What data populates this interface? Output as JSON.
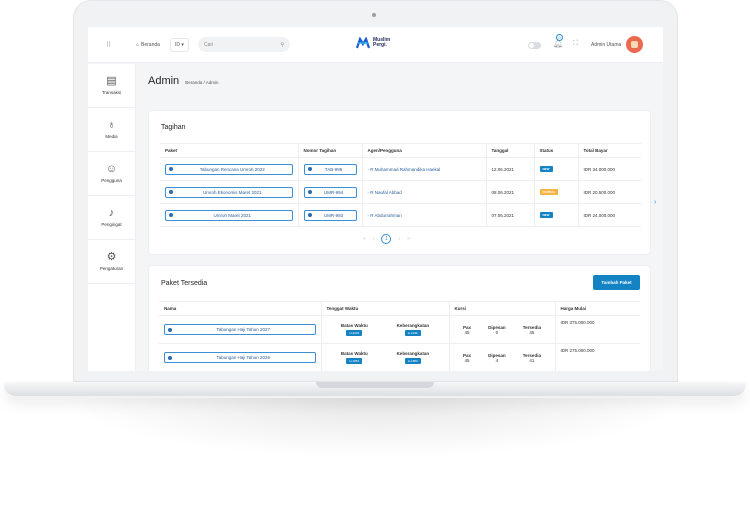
{
  "topbar": {
    "menu_icon": "grid-dots-icon",
    "home_label": "Beranda",
    "lang_label": "ID",
    "search_placeholder": "Cari",
    "logo_line1": "Muslim",
    "logo_line2": "Pergi.",
    "notif_count": "0",
    "user_label": "Admin Utama"
  },
  "sidebar": {
    "items": [
      {
        "label": "Transaksi",
        "icon": "receipt-icon"
      },
      {
        "label": "Media",
        "icon": "lightbulb-icon"
      },
      {
        "label": "Pengguna",
        "icon": "user-icon"
      },
      {
        "label": "Pengingat",
        "icon": "bell-icon"
      },
      {
        "label": "Pengaturan",
        "icon": "settings-icon"
      }
    ]
  },
  "page": {
    "title": "Admin",
    "breadcrumb": "Beranda / Admin"
  },
  "tagihan": {
    "title": "Tagihan",
    "headers": [
      "Paket",
      "Nomor Tagihan",
      "Agen/Pengguna",
      "Tanggal",
      "Status",
      "Total Bayar"
    ],
    "rows": [
      {
        "paket": "Tabungan Rencana Umroh 2022",
        "nomor": "TAB-995",
        "agen": "- R Muhammad Rahmandika Haekal",
        "tanggal": "12.06.2021",
        "status": "NEW",
        "status_color": "#1483c4",
        "total": "IDR 34.000.000"
      },
      {
        "paket": "Umroh Ekonomis Maret 2021",
        "nomor": "UMR-994",
        "agen": "- R Naufal Abbad",
        "tanggal": "08.06.2021",
        "status": "PARTIAL",
        "status_color": "#f5b342",
        "total": "IDR 20.500.000"
      },
      {
        "paket": "Umroh Maret 2021",
        "nomor": "UMR-993",
        "agen": "- R Abdurrahman",
        "tanggal": "07.06.2021",
        "status": "NEW",
        "status_color": "#1483c4",
        "total": "IDR 24.000.000"
      }
    ],
    "pager": {
      "first": "«",
      "prev": "‹",
      "current": "1",
      "next": "›",
      "last": "»"
    }
  },
  "paket": {
    "title": "Paket Tersedia",
    "add_button": "Tambah Paket",
    "headers": [
      "Nama",
      "Tenggat Waktu",
      "Kursi",
      "Harga Mulai"
    ],
    "sub_batas": "Batas Waktu",
    "sub_berangkat": "Keberangkatan",
    "sub_pax": "Pax",
    "sub_dipesan": "Dipesan",
    "sub_tersedia": "Tersedia",
    "rows": [
      {
        "nama": "Tabungan Haji Tahun 2027",
        "batas": "H-2226",
        "berangkat": "H-2236",
        "pax": "45",
        "dipesan": "0",
        "tersedia": "45",
        "harga": "IDR 375.000.000"
      },
      {
        "nama": "Tabungan Haji Tahun 2026",
        "batas": "H-1851",
        "berangkat": "H-1853",
        "pax": "45",
        "dipesan": "4",
        "tersedia": "41",
        "harga": "IDR 275.000.000"
      }
    ]
  }
}
